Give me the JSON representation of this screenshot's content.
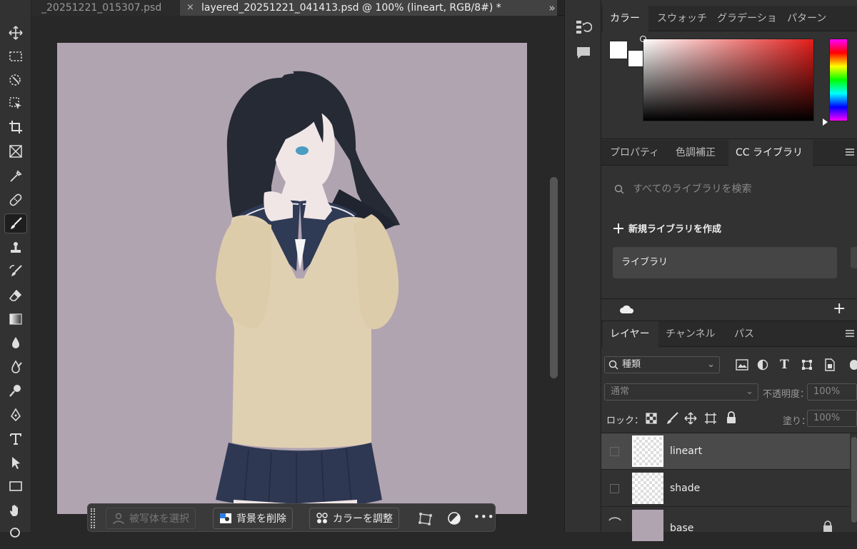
{
  "document_tabs": [
    {
      "label": "_20251221_015307.psd"
    },
    {
      "label": "layered_20251221_041413.psd @ 100% (lineart, RGB/8#) *",
      "active": true
    }
  ],
  "tab_overflow_label": "»",
  "tab_close_glyph": "×",
  "tools": [
    "move-tool",
    "marquee-tool",
    "object-selection-tool",
    "frame-select-tool",
    "crop-tool",
    "frame-tool",
    "eyedropper-tool",
    "healing-brush-tool",
    "brush-tool",
    "clone-stamp-tool",
    "history-brush-tool",
    "eraser-tool",
    "gradient-tool",
    "blur-tool",
    "smudge-tool",
    "dodge-tool",
    "pen-tool",
    "type-tool",
    "path-selection-tool",
    "rectangle-tool",
    "hand-tool"
  ],
  "active_tool": "brush-tool",
  "contextual_taskbar": {
    "select_subject": "被写体を選択",
    "remove_background": "背景を削除",
    "adjust_color": "カラーを調整",
    "more": "•••"
  },
  "color_panel": {
    "tabs": [
      "カラー",
      "スウォッチ",
      "グラデーショ",
      "パターン"
    ],
    "foreground": "#ffffff",
    "background": "#ffffff",
    "hue_color": "#e31d1a"
  },
  "properties_panel": {
    "tabs": [
      "プロパティ",
      "色調補正",
      "CC ライブラリ"
    ],
    "active_tab": "CC ライブラリ",
    "search_placeholder": "すべてのライブラリを検索",
    "new_library": "新規ライブラリを作成",
    "library_name": "ライブラリ",
    "add_glyph": "+"
  },
  "layers_panel": {
    "tabs": [
      "レイヤー",
      "チャンネル",
      "パス"
    ],
    "filter_kind": "種類",
    "blend_mode": "通常",
    "opacity_label": "不透明度：",
    "opacity_value": "100%",
    "lock_label": "ロック：",
    "fill_label": "塗り：",
    "fill_value": "100%",
    "layers": [
      {
        "name": "lineart",
        "selected": true
      },
      {
        "name": "shade",
        "selected": false
      },
      {
        "name": "base",
        "selected": false
      }
    ]
  }
}
